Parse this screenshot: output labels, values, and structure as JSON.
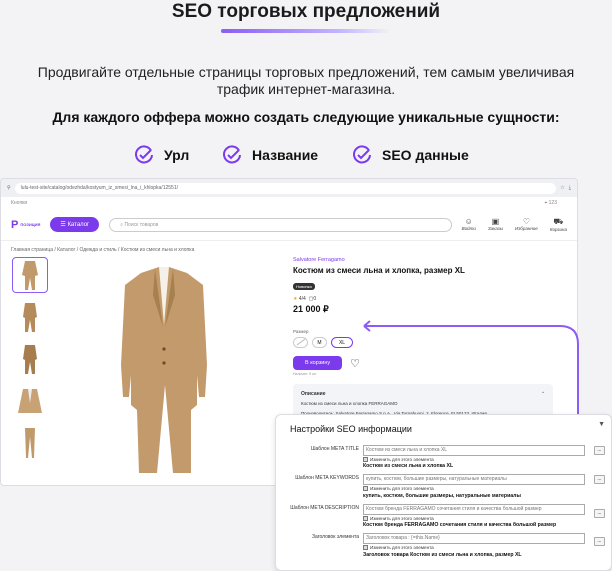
{
  "header": {
    "title": "SEO торговых предложений",
    "subtitle": "Продвигайте отдельные страницы торговых предложений, тем самым увеличивая трафик интернет-магазина.",
    "bold_line": "Для каждого оффера можно создать следующие уникальные сущности:"
  },
  "features": [
    "Урл",
    "Название",
    "SEO данные"
  ],
  "accent": "#7c3aed",
  "browser": {
    "url": "lulu-test-site/catalog/odezhda/kostyum_iz_smesi_lna_i_khlopka/12551/",
    "bookmarks_label": "Кнопки",
    "location": "123",
    "site": {
      "logo": "Р",
      "logo_sub": "ПОЗИЦИЯ",
      "catalog_button": "Каталог",
      "search_placeholder": "Поиск товаров",
      "nav": [
        "Войти",
        "Заказы",
        "Избранное",
        "Корзина"
      ]
    },
    "breadcrumb": "Главная страница / Каталог / Одежда и стиль / Костюм из смеси льна и хлопка",
    "product": {
      "brand": "Salvatore Ferragamo",
      "title": "Костюм из смеси льна и хлопка, размер XL",
      "badge": "Новинка",
      "rating": "4/4",
      "reviews": "0",
      "price": "21 000 ₽",
      "size_label": "Размер",
      "sizes": [
        "",
        "M",
        "XL"
      ],
      "selected_size": "XL",
      "cart_button": "В корзину",
      "cart_sub": "Наличие: 5 шт",
      "description_title": "Описание",
      "description": "Костюм из смеси льна и хлопка FERRAGAMO",
      "manufacturer": "Производитель: Salvatore Ferragamo S.p.A., Via Tornabuoni, 2. Florence, FI 50123. Италия"
    }
  },
  "seo_panel": {
    "title": "Настройки SEO информации",
    "checkbox_label": "Изменить для этого элемента",
    "rows": [
      {
        "label": "Шаблон META TITLE",
        "value": "Костюм из смеси льна и хлопка XL",
        "result": "Костюм из смеси льна и хлопка XL"
      },
      {
        "label": "Шаблон META KEYWORDS",
        "value": "купить, костюм, большие размеры, натуральные материалы",
        "result": "купить, костюм, большие размеры, натуральные материалы"
      },
      {
        "label": "Шаблон META DESCRIPTION",
        "value": "Костюм бренда FERRAGAMO сочетания стиля и качества большой размер",
        "result": "Костюм бренда FERRAGAMO сочетания стиля и качества большой размер"
      },
      {
        "label": "Заголовок элемента",
        "value": "Заголовок товара : {=this.Name}",
        "result": "Заголовок товара Костюм из смеси льна и хлопка, размер XL"
      }
    ],
    "row_button": "..."
  }
}
